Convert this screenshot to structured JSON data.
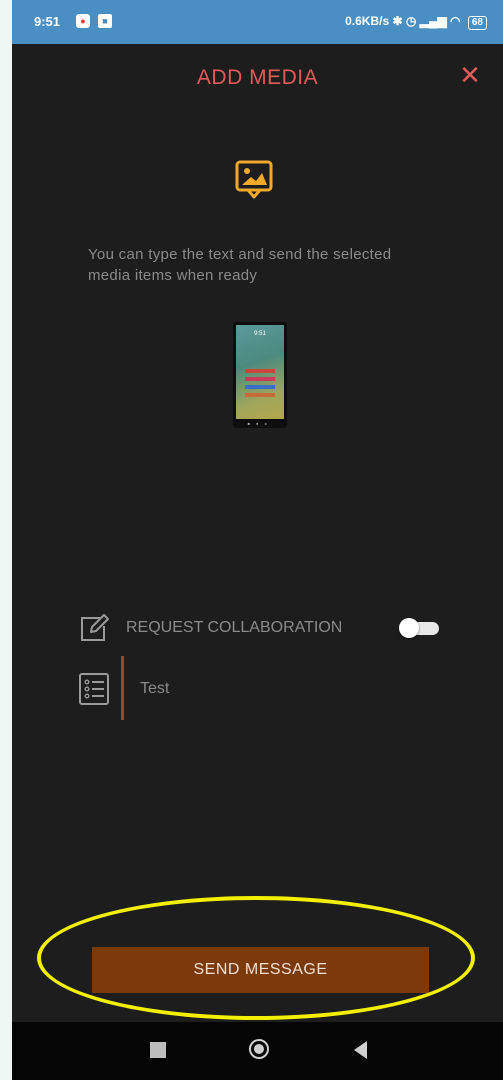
{
  "status_bar": {
    "time": "9:51",
    "network_speed": "0.6KB/s",
    "battery": "68",
    "app_icons": [
      "notification-app-icon",
      "gallery-app-icon"
    ],
    "right_icons": [
      "bluetooth-icon",
      "alarm-icon",
      "signal-icon",
      "vowifi-icon",
      "signal-icon",
      "vowifi-icon",
      "wifi-icon",
      "battery-icon"
    ]
  },
  "header": {
    "title": "ADD MEDIA",
    "close_icon": "close-icon"
  },
  "media": {
    "icon": "image-icon",
    "hint": "You can type the text and send the selected media items when ready",
    "thumbnail_icon": "media-thumbnail",
    "thumbnail_clock": "9:51"
  },
  "collaboration": {
    "icon": "edit-icon",
    "label": "REQUEST COLLABORATION",
    "toggle_on": false
  },
  "message": {
    "icon": "list-icon",
    "text": "Test"
  },
  "send_button": {
    "label": "SEND MESSAGE"
  },
  "nav_bar": {
    "icons": [
      "recents-icon",
      "home-icon",
      "back-icon"
    ]
  },
  "colors": {
    "accent": "#e05a5a",
    "button": "#7c3a0a",
    "background": "#1d1d1d",
    "status_bar": "#4a8fc3",
    "highlight": "#f2f000"
  }
}
